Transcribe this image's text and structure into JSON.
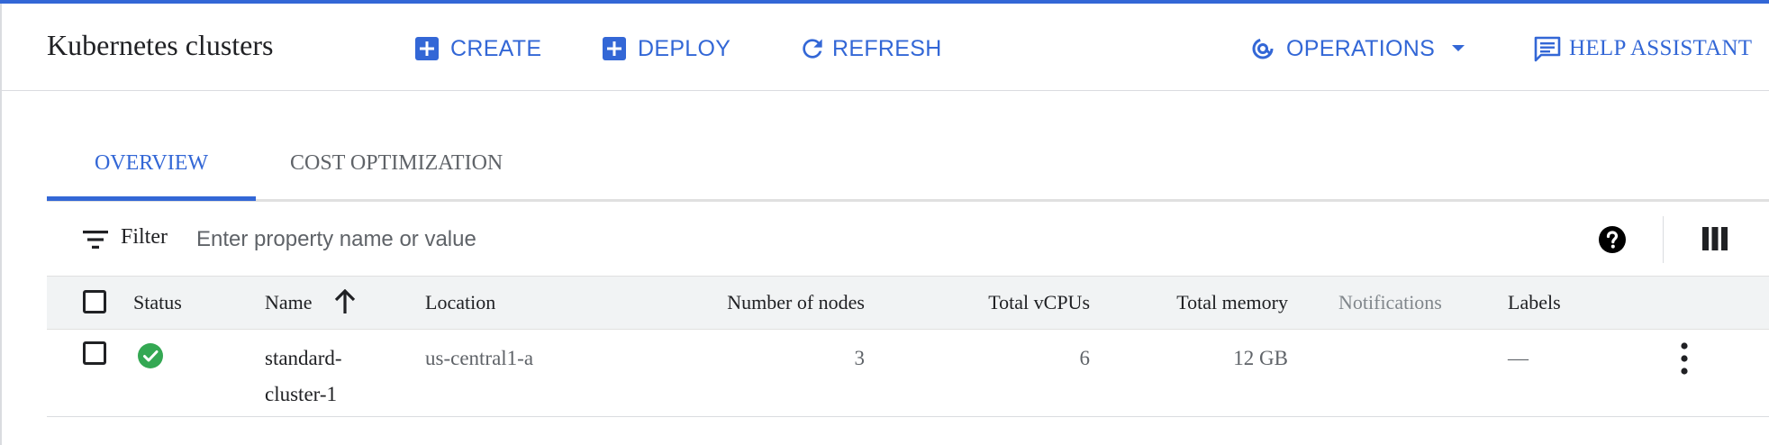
{
  "header": {
    "title": "Kubernetes clusters",
    "create_label": "CREATE",
    "deploy_label": "DEPLOY",
    "refresh_label": "REFRESH",
    "operations_label": "OPERATIONS",
    "help_label": "HELP ASSISTANT"
  },
  "tabs": [
    {
      "label": "OVERVIEW",
      "active": true
    },
    {
      "label": "COST OPTIMIZATION",
      "active": false
    }
  ],
  "filter": {
    "label": "Filter",
    "placeholder": "Enter property name or value"
  },
  "table": {
    "columns": {
      "status": "Status",
      "name": "Name",
      "location": "Location",
      "nodes": "Number of nodes",
      "vcpus": "Total vCPUs",
      "memory": "Total memory",
      "notifications": "Notifications",
      "labels": "Labels"
    },
    "sort": {
      "column": "name",
      "direction": "ascending"
    },
    "rows": [
      {
        "status": "ok",
        "name_line1": "standard-",
        "name_line2": "cluster-1",
        "location": "us-central1-a",
        "nodes": "3",
        "vcpus": "6",
        "memory": "12 GB",
        "notifications": "",
        "labels": "—"
      }
    ]
  },
  "icons": {
    "create": "add-box-icon",
    "deploy": "add-box-icon",
    "refresh": "refresh-icon",
    "operations": "operations-icon",
    "help": "chat-icon",
    "filter": "filter-icon",
    "help_table": "help-icon",
    "columns": "columns-icon",
    "status_ok": "check-circle-icon",
    "row_menu": "more-vert-icon"
  },
  "colors": {
    "accent": "#3367d6",
    "status_ok": "#34a853",
    "header_bg": "#f1f3f4"
  }
}
